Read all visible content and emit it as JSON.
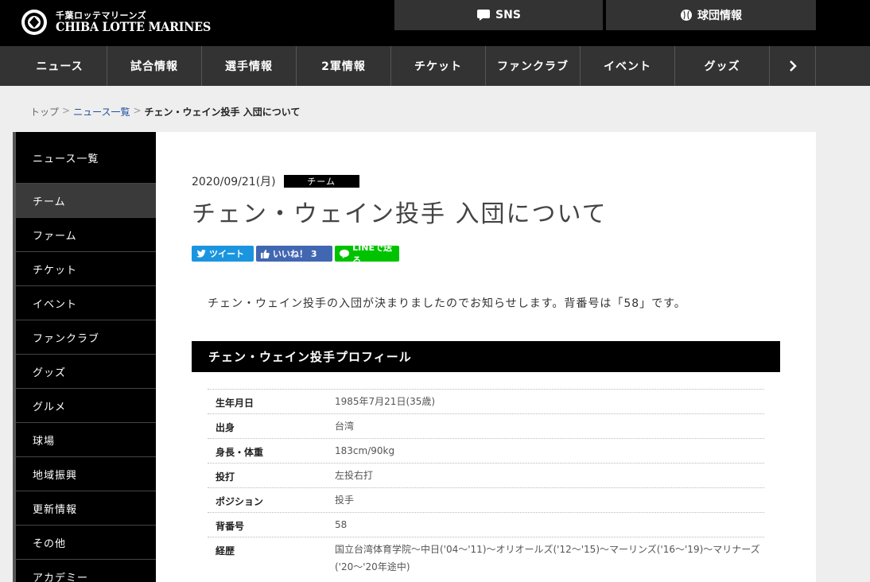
{
  "header": {
    "brand_jp": "千葉ロッテマリーンズ",
    "brand_en": "CHIBA LOTTE MARINES",
    "sns_label": "SNS",
    "team_info_label": "球団情報"
  },
  "nav": {
    "items": [
      {
        "label": "ニュース"
      },
      {
        "label": "試合情報"
      },
      {
        "label": "選手情報"
      },
      {
        "label": "2軍情報"
      },
      {
        "label": "チケット"
      },
      {
        "label": "ファンクラブ"
      },
      {
        "label": "イベント"
      },
      {
        "label": "グッズ"
      }
    ]
  },
  "breadcrumb": {
    "top": "トップ",
    "news": "ニュース一覧",
    "current": "チェン・ウェイン投手 入団について"
  },
  "sidebar": {
    "heading": "ニュース一覧",
    "items": [
      {
        "label": "チーム"
      },
      {
        "label": "ファーム"
      },
      {
        "label": "チケット"
      },
      {
        "label": "イベント"
      },
      {
        "label": "ファンクラブ"
      },
      {
        "label": "グッズ"
      },
      {
        "label": "グルメ"
      },
      {
        "label": "球場"
      },
      {
        "label": "地域振興"
      },
      {
        "label": "更新情報"
      },
      {
        "label": "その他"
      },
      {
        "label": "アカデミー"
      }
    ]
  },
  "article": {
    "date": "2020/09/21(月)",
    "category": "チーム",
    "title": "チェン・ウェイン投手 入団について",
    "share": {
      "tweet": "ツイート",
      "like": "いいね！ 3",
      "line": "LINEで送る"
    },
    "lead": "チェン・ウェイン投手の入団が決まりましたのでお知らせします。背番号は「58」です。",
    "profile_heading": "チェン・ウェイン投手プロフィール",
    "profile": [
      {
        "key": "生年月日",
        "value": "1985年7月21日(35歳)"
      },
      {
        "key": "出身",
        "value": "台湾"
      },
      {
        "key": "身長・体重",
        "value": "183cm/90kg"
      },
      {
        "key": "投打",
        "value": "左投右打"
      },
      {
        "key": "ポジション",
        "value": "投手"
      },
      {
        "key": "背番号",
        "value": "58"
      },
      {
        "key": "経歴",
        "value": "国立台湾体育学院～中日('04～'11)～オリオールズ('12～'15)～マーリンズ('16～'19)～マリナーズ('20～'20年途中)"
      }
    ]
  },
  "colors": {
    "header_bg": "#000000",
    "nav_bg": "#333333",
    "twitter": "#1b95e0",
    "facebook": "#4267b2",
    "line": "#00c300"
  }
}
